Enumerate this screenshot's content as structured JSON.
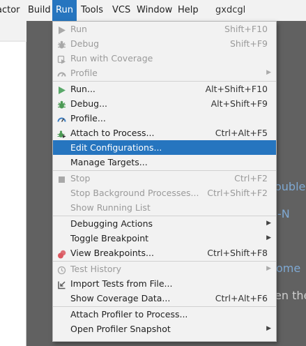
{
  "menubar": {
    "items": [
      "actor",
      "Build",
      "Run",
      "Tools",
      "VCS",
      "Window",
      "Help"
    ],
    "project": "gxdcgl"
  },
  "background": {
    "tool_strip": [
      "×",
      "—"
    ],
    "fragments": [
      "ouble",
      "-N",
      "ome",
      "en the"
    ]
  },
  "menu": {
    "sections": [
      {
        "items": [
          {
            "label": "Run",
            "shortcut": "Shift+F10",
            "disabled": true,
            "icon": "run-icon"
          },
          {
            "label": "Debug",
            "shortcut": "Shift+F9",
            "disabled": true,
            "icon": "debug-icon"
          },
          {
            "label": "Run with Coverage",
            "shortcut": "",
            "disabled": true,
            "icon": "coverage-icon"
          },
          {
            "label": "Profile",
            "shortcut": "",
            "disabled": true,
            "icon": "profile-icon",
            "submenu": true
          }
        ]
      },
      {
        "items": [
          {
            "label": "Run...",
            "shortcut": "Alt+Shift+F10",
            "disabled": false,
            "icon": "run-icon"
          },
          {
            "label": "Debug...",
            "shortcut": "Alt+Shift+F9",
            "disabled": false,
            "icon": "debug-icon"
          },
          {
            "label": "Profile...",
            "shortcut": "",
            "disabled": false,
            "icon": "profile-icon"
          },
          {
            "label": "Attach to Process...",
            "shortcut": "Ctrl+Alt+F5",
            "disabled": false,
            "icon": "attach-icon"
          },
          {
            "label": "Edit Configurations...",
            "shortcut": "",
            "disabled": false,
            "selected": true
          },
          {
            "label": "Manage Targets...",
            "shortcut": "",
            "disabled": false
          }
        ]
      },
      {
        "items": [
          {
            "label": "Stop",
            "shortcut": "Ctrl+F2",
            "disabled": true,
            "icon": "stop-icon"
          },
          {
            "label": "Stop Background Processes...",
            "shortcut": "Ctrl+Shift+F2",
            "disabled": true
          },
          {
            "label": "Show Running List",
            "shortcut": "",
            "disabled": true
          }
        ]
      },
      {
        "items": [
          {
            "label": "Debugging Actions",
            "shortcut": "",
            "disabled": false,
            "submenu": true
          },
          {
            "label": "Toggle Breakpoint",
            "shortcut": "",
            "disabled": false,
            "submenu": true
          },
          {
            "label": "View Breakpoints...",
            "shortcut": "Ctrl+Shift+F8",
            "disabled": false,
            "icon": "breakpoints-icon"
          }
        ]
      },
      {
        "items": [
          {
            "label": "Test History",
            "shortcut": "",
            "disabled": true,
            "icon": "history-icon",
            "submenu": true
          },
          {
            "label": "Import Tests from File...",
            "shortcut": "",
            "disabled": false,
            "icon": "import-icon"
          },
          {
            "label": "Show Coverage Data...",
            "shortcut": "Ctrl+Alt+F6",
            "disabled": false
          }
        ]
      },
      {
        "items": [
          {
            "label": "Attach Profiler to Process...",
            "shortcut": "",
            "disabled": false
          },
          {
            "label": "Open Profiler Snapshot",
            "shortcut": "",
            "disabled": false,
            "submenu": true
          }
        ]
      }
    ]
  },
  "colors": {
    "selection": "#2675bf",
    "run_green": "#59a869",
    "debug_green": "#4c9a55",
    "breakpoint_red": "#db5860"
  }
}
